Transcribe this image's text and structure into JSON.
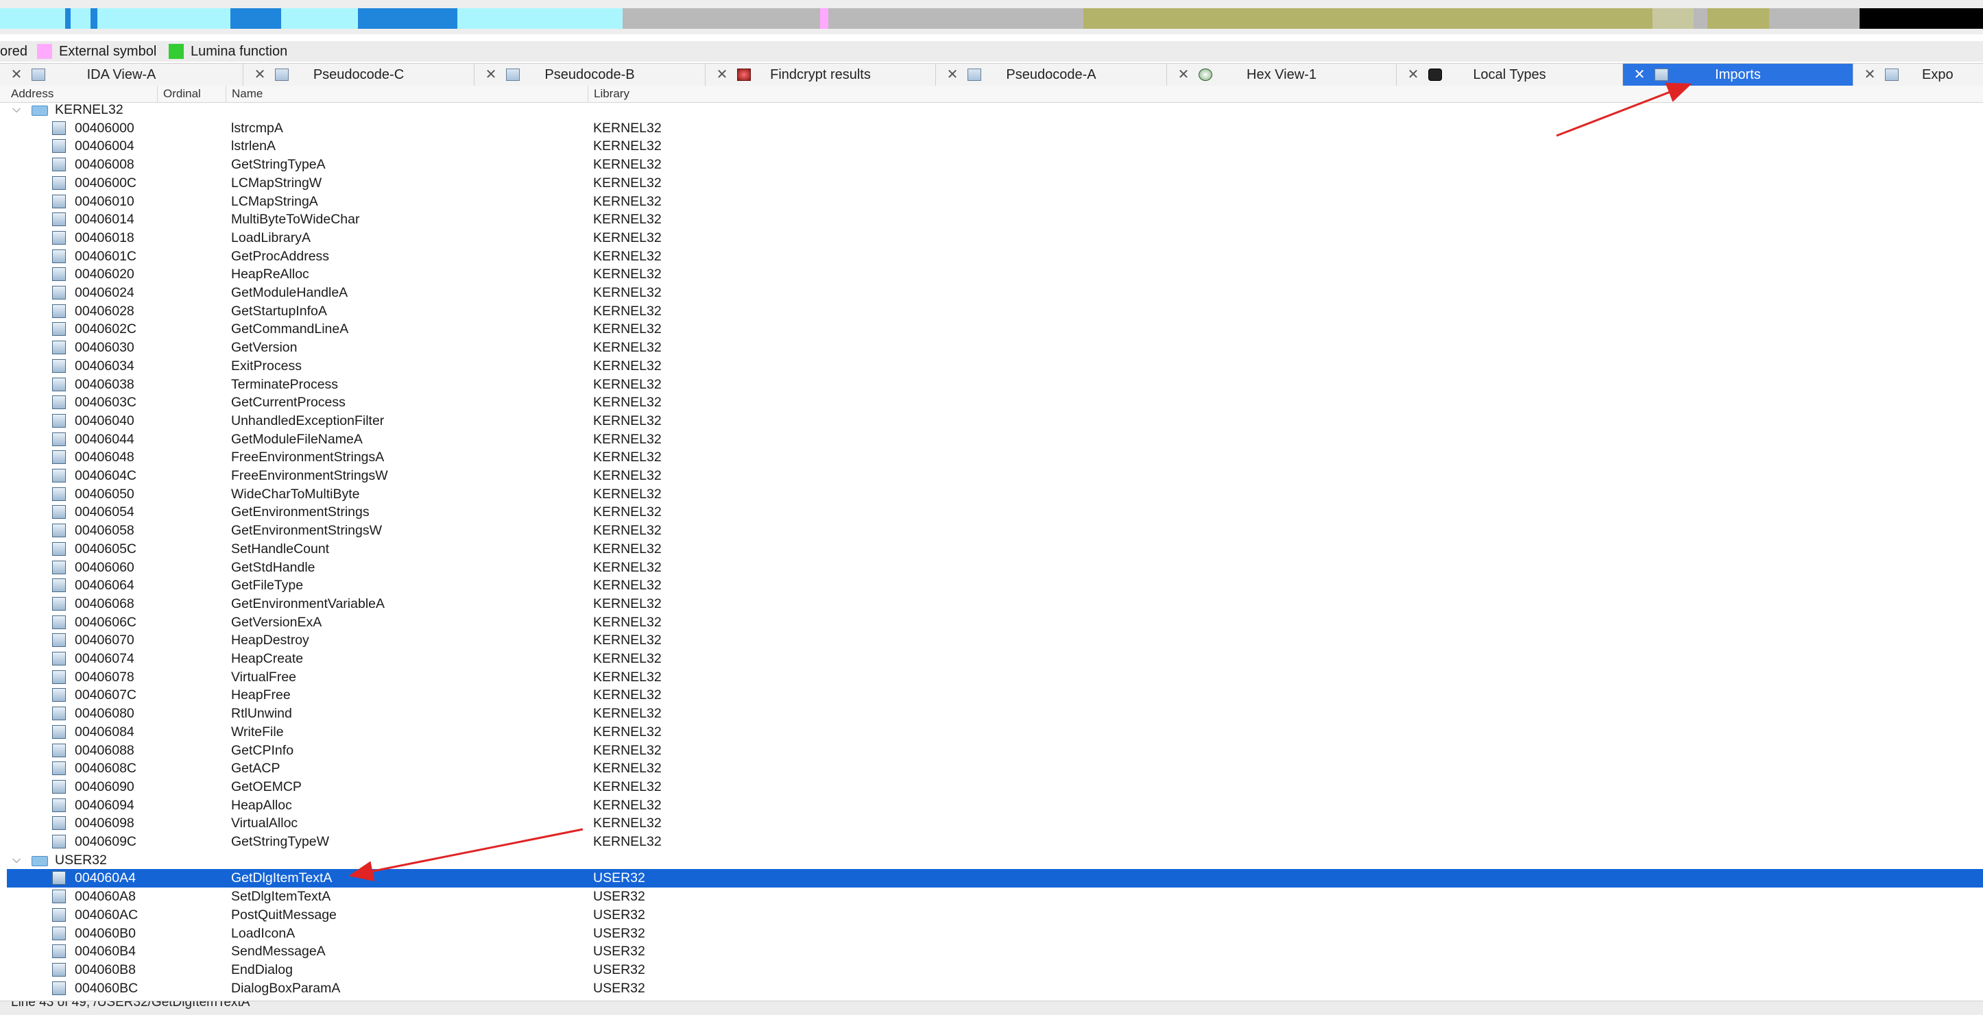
{
  "legend": {
    "items": [
      {
        "label": "ored",
        "color": ""
      },
      {
        "label": "External symbol",
        "color": "#ffaaff"
      },
      {
        "label": "Lumina function",
        "color": "#33cc33"
      }
    ]
  },
  "navbar": {
    "icons": [
      "navigation-band"
    ]
  },
  "tabs": [
    {
      "label": "IDA View-A",
      "icon": "disassembly-icon",
      "active": false
    },
    {
      "label": "Pseudocode-C",
      "icon": "pseudocode-icon",
      "active": false
    },
    {
      "label": "Pseudocode-B",
      "icon": "pseudocode-icon",
      "active": false
    },
    {
      "label": "Findcrypt results",
      "icon": "findcrypt-icon",
      "active": false
    },
    {
      "label": "Pseudocode-A",
      "icon": "pseudocode-icon",
      "active": false
    },
    {
      "label": "Hex View-1",
      "icon": "hex-icon",
      "active": false
    },
    {
      "label": "Local Types",
      "icon": "types-icon",
      "active": false
    },
    {
      "label": "Imports",
      "icon": "imports-icon",
      "active": true
    },
    {
      "label": "Expo",
      "icon": "exports-icon",
      "active": false
    }
  ],
  "columns": {
    "address": "Address",
    "ordinal": "Ordinal",
    "name": "Name",
    "library": "Library"
  },
  "groups": [
    {
      "label": "KERNEL32",
      "rows": [
        {
          "address": "00406000",
          "name": "lstrcmpA",
          "library": "KERNEL32"
        },
        {
          "address": "00406004",
          "name": "lstrlenA",
          "library": "KERNEL32"
        },
        {
          "address": "00406008",
          "name": "GetStringTypeA",
          "library": "KERNEL32"
        },
        {
          "address": "0040600C",
          "name": "LCMapStringW",
          "library": "KERNEL32"
        },
        {
          "address": "00406010",
          "name": "LCMapStringA",
          "library": "KERNEL32"
        },
        {
          "address": "00406014",
          "name": "MultiByteToWideChar",
          "library": "KERNEL32"
        },
        {
          "address": "00406018",
          "name": "LoadLibraryA",
          "library": "KERNEL32"
        },
        {
          "address": "0040601C",
          "name": "GetProcAddress",
          "library": "KERNEL32"
        },
        {
          "address": "00406020",
          "name": "HeapReAlloc",
          "library": "KERNEL32"
        },
        {
          "address": "00406024",
          "name": "GetModuleHandleA",
          "library": "KERNEL32"
        },
        {
          "address": "00406028",
          "name": "GetStartupInfoA",
          "library": "KERNEL32"
        },
        {
          "address": "0040602C",
          "name": "GetCommandLineA",
          "library": "KERNEL32"
        },
        {
          "address": "00406030",
          "name": "GetVersion",
          "library": "KERNEL32"
        },
        {
          "address": "00406034",
          "name": "ExitProcess",
          "library": "KERNEL32"
        },
        {
          "address": "00406038",
          "name": "TerminateProcess",
          "library": "KERNEL32"
        },
        {
          "address": "0040603C",
          "name": "GetCurrentProcess",
          "library": "KERNEL32"
        },
        {
          "address": "00406040",
          "name": "UnhandledExceptionFilter",
          "library": "KERNEL32"
        },
        {
          "address": "00406044",
          "name": "GetModuleFileNameA",
          "library": "KERNEL32"
        },
        {
          "address": "00406048",
          "name": "FreeEnvironmentStringsA",
          "library": "KERNEL32"
        },
        {
          "address": "0040604C",
          "name": "FreeEnvironmentStringsW",
          "library": "KERNEL32"
        },
        {
          "address": "00406050",
          "name": "WideCharToMultiByte",
          "library": "KERNEL32"
        },
        {
          "address": "00406054",
          "name": "GetEnvironmentStrings",
          "library": "KERNEL32"
        },
        {
          "address": "00406058",
          "name": "GetEnvironmentStringsW",
          "library": "KERNEL32"
        },
        {
          "address": "0040605C",
          "name": "SetHandleCount",
          "library": "KERNEL32"
        },
        {
          "address": "00406060",
          "name": "GetStdHandle",
          "library": "KERNEL32"
        },
        {
          "address": "00406064",
          "name": "GetFileType",
          "library": "KERNEL32"
        },
        {
          "address": "00406068",
          "name": "GetEnvironmentVariableA",
          "library": "KERNEL32"
        },
        {
          "address": "0040606C",
          "name": "GetVersionExA",
          "library": "KERNEL32"
        },
        {
          "address": "00406070",
          "name": "HeapDestroy",
          "library": "KERNEL32"
        },
        {
          "address": "00406074",
          "name": "HeapCreate",
          "library": "KERNEL32"
        },
        {
          "address": "00406078",
          "name": "VirtualFree",
          "library": "KERNEL32"
        },
        {
          "address": "0040607C",
          "name": "HeapFree",
          "library": "KERNEL32"
        },
        {
          "address": "00406080",
          "name": "RtlUnwind",
          "library": "KERNEL32"
        },
        {
          "address": "00406084",
          "name": "WriteFile",
          "library": "KERNEL32"
        },
        {
          "address": "00406088",
          "name": "GetCPInfo",
          "library": "KERNEL32"
        },
        {
          "address": "0040608C",
          "name": "GetACP",
          "library": "KERNEL32"
        },
        {
          "address": "00406090",
          "name": "GetOEMCP",
          "library": "KERNEL32"
        },
        {
          "address": "00406094",
          "name": "HeapAlloc",
          "library": "KERNEL32"
        },
        {
          "address": "00406098",
          "name": "VirtualAlloc",
          "library": "KERNEL32"
        },
        {
          "address": "0040609C",
          "name": "GetStringTypeW",
          "library": "KERNEL32"
        }
      ]
    },
    {
      "label": "USER32",
      "rows": [
        {
          "address": "004060A4",
          "name": "GetDlgItemTextA",
          "library": "USER32",
          "selected": true
        },
        {
          "address": "004060A8",
          "name": "SetDlgItemTextA",
          "library": "USER32"
        },
        {
          "address": "004060AC",
          "name": "PostQuitMessage",
          "library": "USER32"
        },
        {
          "address": "004060B0",
          "name": "LoadIconA",
          "library": "USER32"
        },
        {
          "address": "004060B4",
          "name": "SendMessageA",
          "library": "USER32"
        },
        {
          "address": "004060B8",
          "name": "EndDialog",
          "library": "USER32"
        },
        {
          "address": "004060BC",
          "name": "DialogBoxParamA",
          "library": "USER32"
        }
      ]
    }
  ],
  "status": {
    "text": "Line 43 of 49, /USER32/GetDlgItemTextA"
  },
  "colors": {
    "selection": "#1464d6",
    "active_tab": "#2a73e3",
    "annotation_arrow": "#e02424"
  }
}
